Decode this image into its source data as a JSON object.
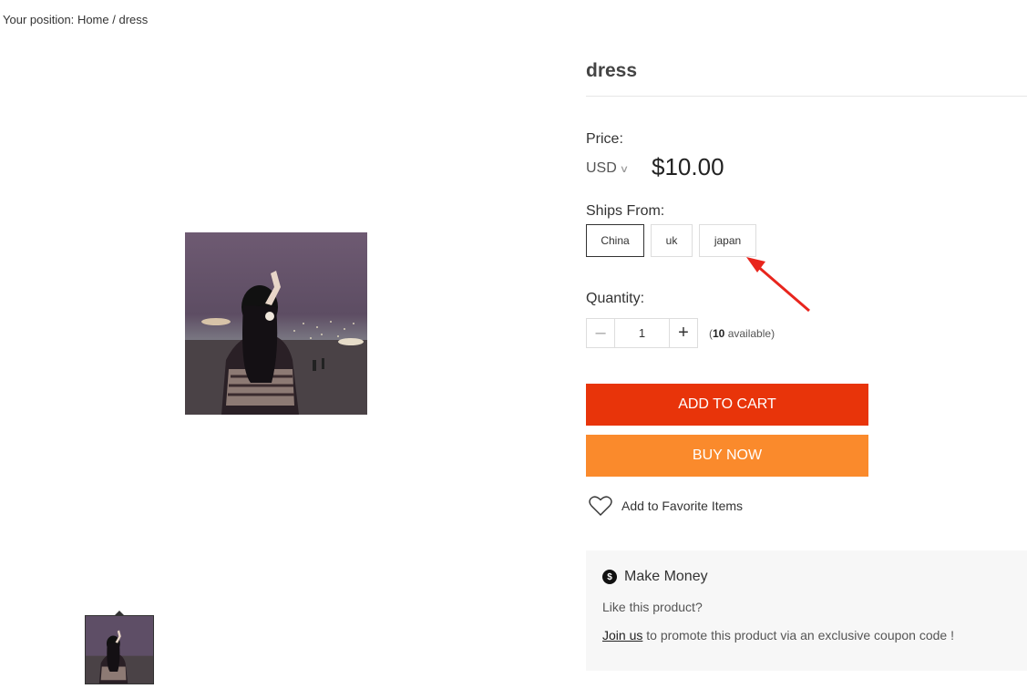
{
  "breadcrumb": {
    "prefix": "Your position:",
    "home": "Home",
    "separator": "/",
    "current": "dress"
  },
  "product": {
    "title": "dress",
    "price_label": "Price:",
    "currency": "USD",
    "price": "$10.00",
    "ships_from_label": "Ships From:",
    "ships_from_options": [
      "China",
      "uk",
      "japan"
    ],
    "ships_from_selected": "China",
    "quantity_label": "Quantity:",
    "quantity_value": "1",
    "available_count": "10",
    "available_text": "available)",
    "available_open": "("
  },
  "actions": {
    "add_to_cart": "ADD TO CART",
    "buy_now": "BUY NOW",
    "favorite": "Add to Favorite Items"
  },
  "make_money": {
    "title": "Make Money",
    "question": "Like this product?",
    "join_link": "Join us",
    "join_text": " to promote this product via an exclusive coupon code !"
  },
  "colors": {
    "add_to_cart": "#e8340a",
    "buy_now": "#fa8a2c",
    "annotation_arrow": "#e8251d"
  },
  "icons": {
    "currency_dropdown": "chevron-down-icon",
    "favorite": "heart-outline-icon",
    "make_money": "dollar-circle-icon",
    "qty_minus": "minus-icon",
    "qty_plus": "plus-icon"
  }
}
